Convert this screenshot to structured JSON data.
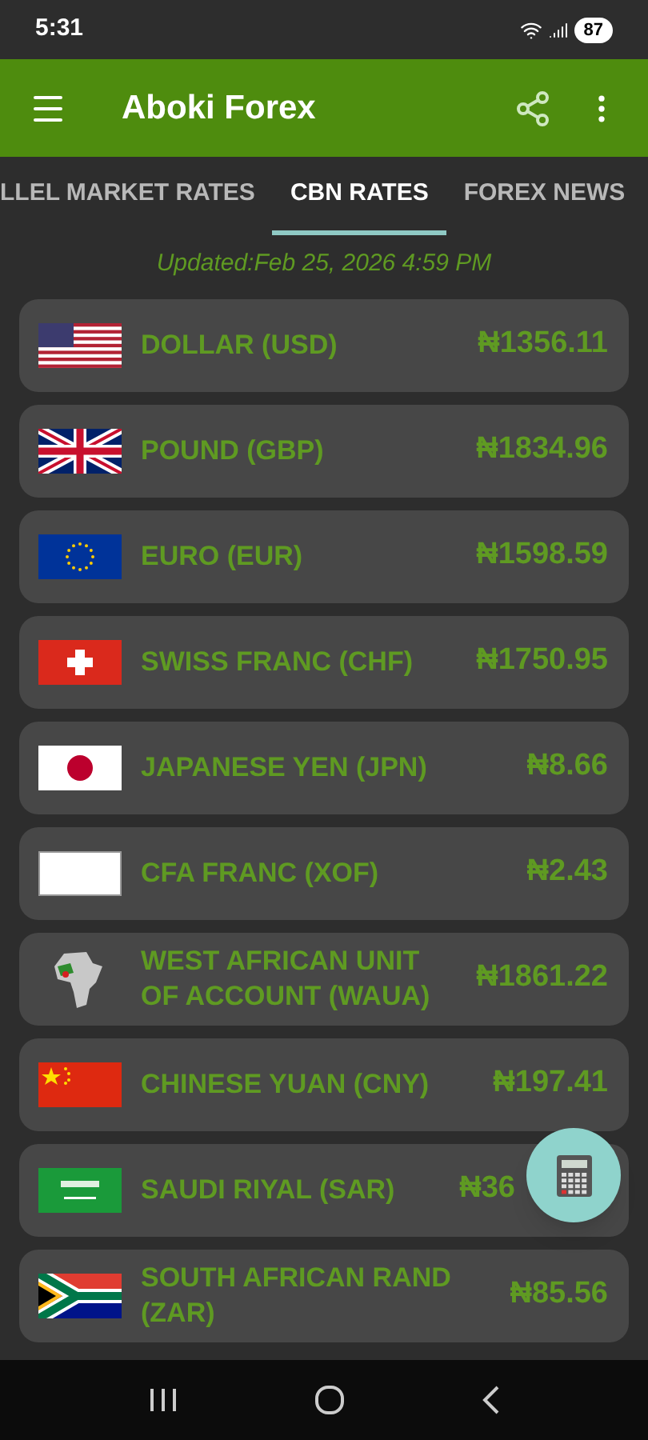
{
  "status_bar": {
    "time": "5:31",
    "battery": "87"
  },
  "app_bar": {
    "title": "Aboki Forex"
  },
  "tabs": [
    {
      "label": "LLEL MARKET RATES",
      "selected": false
    },
    {
      "label": "CBN RATES",
      "selected": true
    },
    {
      "label": "FOREX NEWS",
      "selected": false
    }
  ],
  "updated": "Updated:Feb 25, 2026 4:59 PM",
  "rates": [
    {
      "kind": "usd",
      "name": "DOLLAR (USD)",
      "rate": "₦1356.11"
    },
    {
      "kind": "gbp",
      "name": "POUND (GBP)",
      "rate": "₦1834.96"
    },
    {
      "kind": "eur",
      "name": "EURO (EUR)",
      "rate": "₦1598.59"
    },
    {
      "kind": "chf",
      "name": "SWISS FRANC (CHF)",
      "rate": "₦1750.95"
    },
    {
      "kind": "jpy",
      "name": "JAPANESE YEN (JPN)",
      "rate": "₦8.66"
    },
    {
      "kind": "xof",
      "name": "CFA FRANC (XOF)",
      "rate": "₦2.43"
    },
    {
      "kind": "waua",
      "name": "WEST AFRICAN UNIT OF ACCOUNT (WAUA)",
      "rate": "₦1861.22"
    },
    {
      "kind": "cny",
      "name": "CHINESE YUAN (CNY)",
      "rate": "₦197.41"
    },
    {
      "kind": "sar",
      "name": "SAUDI RIYAL (SAR)",
      "rate": "₦36",
      "under_button": true
    },
    {
      "kind": "zar",
      "name": "SOUTH AFRICAN RAND (ZAR)",
      "rate": "₦85.56"
    }
  ]
}
